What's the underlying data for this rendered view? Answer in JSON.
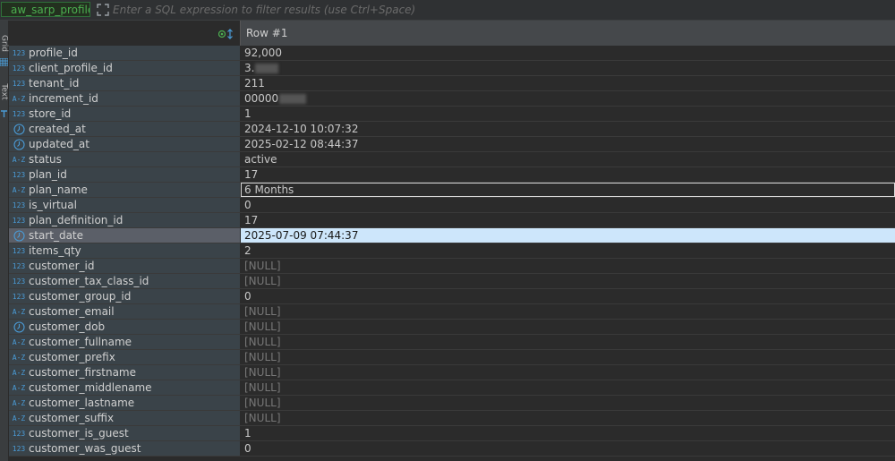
{
  "filter_bar": {
    "table_name": "aw_sarp_profile",
    "placeholder": "Enter a SQL expression to filter results (use Ctrl+Space)"
  },
  "side_tabs": [
    "Grid",
    "Text"
  ],
  "grid": {
    "row_header": "Row  #1",
    "rows": [
      {
        "name": "profile_id",
        "type": "123",
        "value": "92,000"
      },
      {
        "name": "client_profile_id",
        "type": "123",
        "value": "3.",
        "redacted": true
      },
      {
        "name": "tenant_id",
        "type": "123",
        "value": "211"
      },
      {
        "name": "increment_id",
        "type": "A-Z",
        "value": "00000",
        "redacted": true
      },
      {
        "name": "store_id",
        "type": "123",
        "value": "1"
      },
      {
        "name": "created_at",
        "type": "clock",
        "value": "2024-12-10 10:07:32"
      },
      {
        "name": "updated_at",
        "type": "clock",
        "value": "2025-02-12 08:44:37"
      },
      {
        "name": "status",
        "type": "A-Z",
        "value": "active"
      },
      {
        "name": "plan_id",
        "type": "123",
        "value": "17"
      },
      {
        "name": "plan_name",
        "type": "A-Z",
        "value": "6 Months",
        "focused": true
      },
      {
        "name": "is_virtual",
        "type": "123",
        "value": "0"
      },
      {
        "name": "plan_definition_id",
        "type": "123",
        "value": "17"
      },
      {
        "name": "start_date",
        "type": "clock",
        "value": "2025-07-09 07:44:37",
        "selected": true
      },
      {
        "name": "items_qty",
        "type": "123",
        "value": "2"
      },
      {
        "name": "customer_id",
        "type": "123",
        "value": "[NULL]",
        "null": true
      },
      {
        "name": "customer_tax_class_id",
        "type": "123",
        "value": "[NULL]",
        "null": true
      },
      {
        "name": "customer_group_id",
        "type": "123",
        "value": "0"
      },
      {
        "name": "customer_email",
        "type": "A-Z",
        "value": "[NULL]",
        "null": true
      },
      {
        "name": "customer_dob",
        "type": "clock",
        "value": "[NULL]",
        "null": true
      },
      {
        "name": "customer_fullname",
        "type": "A-Z",
        "value": "[NULL]",
        "null": true
      },
      {
        "name": "customer_prefix",
        "type": "A-Z",
        "value": "[NULL]",
        "null": true
      },
      {
        "name": "customer_firstname",
        "type": "A-Z",
        "value": "[NULL]",
        "null": true
      },
      {
        "name": "customer_middlename",
        "type": "A-Z",
        "value": "[NULL]",
        "null": true
      },
      {
        "name": "customer_lastname",
        "type": "A-Z",
        "value": "[NULL]",
        "null": true
      },
      {
        "name": "customer_suffix",
        "type": "A-Z",
        "value": "[NULL]",
        "null": true
      },
      {
        "name": "customer_is_guest",
        "type": "123",
        "value": "1"
      },
      {
        "name": "customer_was_guest",
        "type": "123",
        "value": "0"
      }
    ]
  },
  "colors": {
    "accent_green": "#4caf50",
    "type_blue": "#4a9bd6",
    "selection": "#cde6fb"
  }
}
